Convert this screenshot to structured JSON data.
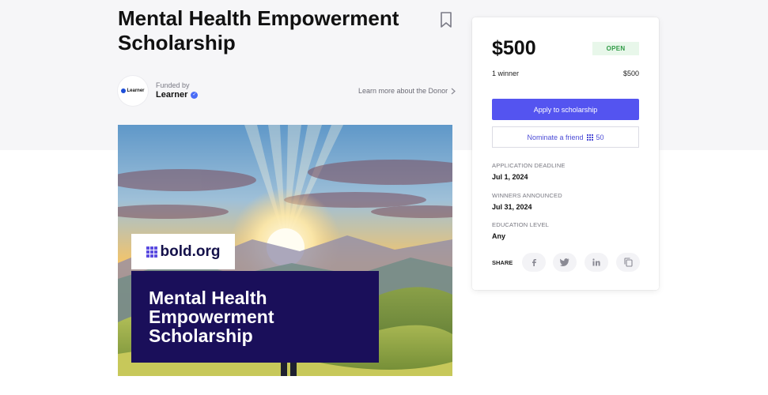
{
  "scholarship": {
    "title": "Mental Health Empowerment Scholarship"
  },
  "funder": {
    "logo_text": "Learner",
    "funded_by_label": "Funded by",
    "name": "Learner",
    "learn_more": "Learn more about the Donor",
    "learn_more_icon": "chevron-right-icon"
  },
  "hero": {
    "brand": "bold.org",
    "headline": "Mental Health Empowerment Scholarship"
  },
  "card": {
    "amount": "$500",
    "status": "OPEN",
    "winners": "1 winner",
    "winner_amount": "$500",
    "apply_label": "Apply to scholarship",
    "nominate_label": "Nominate a friend",
    "nominate_points": "50",
    "deadline_label": "APPLICATION DEADLINE",
    "deadline_value": "Jul 1, 2024",
    "announced_label": "WINNERS ANNOUNCED",
    "announced_value": "Jul 31, 2024",
    "education_label": "EDUCATION LEVEL",
    "education_value": "Any",
    "share_label": "SHARE",
    "share_icons": [
      "facebook-icon",
      "twitter-icon",
      "linkedin-icon",
      "copy-icon"
    ]
  },
  "colors": {
    "accent": "#5454f0",
    "status_green": "#2f9a45",
    "hero_box": "#1a0f5a"
  }
}
